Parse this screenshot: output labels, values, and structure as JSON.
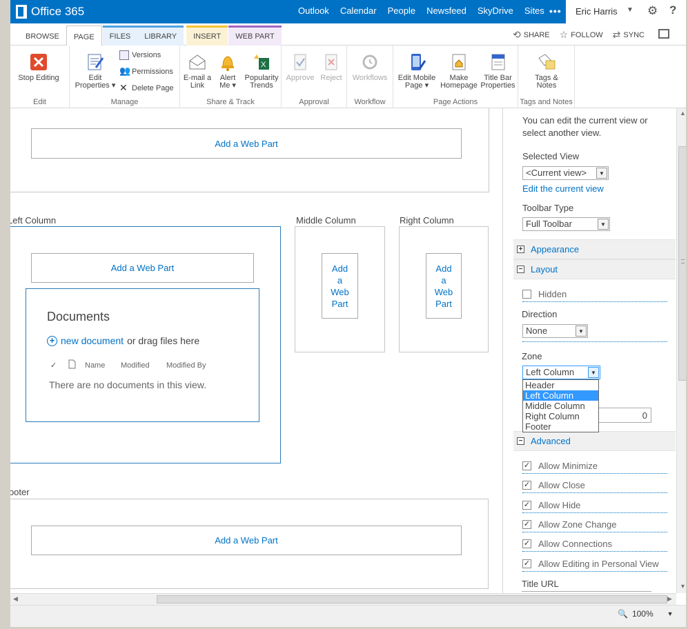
{
  "suite": {
    "brand": "Office 365",
    "nav": [
      "Outlook",
      "Calendar",
      "People",
      "Newsfeed",
      "SkyDrive",
      "Sites"
    ],
    "active_nav": "Sites",
    "more": "•••",
    "user": "Eric Harris",
    "help": "?"
  },
  "ribbon_tabs": {
    "browse": "BROWSE",
    "page": "PAGE",
    "files": "FILES",
    "library": "LIBRARY",
    "insert": "INSERT",
    "web_part": "WEB PART",
    "share": "SHARE",
    "follow": "FOLLOW",
    "sync": "SYNC"
  },
  "ribbon": {
    "edit": {
      "label": "Edit",
      "stop_editing": "Stop Editing"
    },
    "manage": {
      "label": "Manage",
      "edit_properties_1": "Edit",
      "edit_properties_2": "Properties",
      "versions": "Versions",
      "permissions": "Permissions",
      "delete_page": "Delete Page"
    },
    "share_track": {
      "label": "Share & Track",
      "email_1": "E-mail a",
      "email_2": "Link",
      "alert_1": "Alert",
      "alert_2": "Me",
      "popularity_1": "Popularity",
      "popularity_2": "Trends"
    },
    "approval": {
      "label": "Approval",
      "approve": "Approve",
      "reject": "Reject"
    },
    "workflow": {
      "label": "Workflow",
      "workflows": "Workflows"
    },
    "page_actions": {
      "label": "Page Actions",
      "mobile_1": "Edit Mobile",
      "mobile_2": "Page",
      "home_1": "Make",
      "home_2": "Homepage",
      "titlebar_1": "Title Bar",
      "titlebar_2": "Properties"
    },
    "tags": {
      "label": "Tags and Notes",
      "tags_1": "Tags &",
      "tags_2": "Notes"
    }
  },
  "content": {
    "add_web_part": "Add a Web Part",
    "add_wp_narrow": [
      "Add",
      "a",
      "Web",
      "Part"
    ],
    "left_column": "Left Column",
    "middle_column": "Middle Column",
    "right_column": "Right Column",
    "footer": "Footer",
    "documents": {
      "title": "Documents",
      "new_document": "new document",
      "drag_text": "or drag files here",
      "col_name": "Name",
      "col_modified": "Modified",
      "col_modified_by": "Modified By",
      "empty": "There are no documents in this view."
    }
  },
  "toolpane": {
    "intro_1": "You can edit the current view or",
    "intro_2": "select another view.",
    "selected_view_label": "Selected View",
    "selected_view": "<Current view>",
    "edit_current_view": "Edit the current view",
    "toolbar_type_label": "Toolbar Type",
    "toolbar_type": "Full Toolbar",
    "appearance": "Appearance",
    "layout": "Layout",
    "hidden": "Hidden",
    "direction_label": "Direction",
    "direction": "None",
    "zone_label": "Zone",
    "zone": "Left Column",
    "zone_options": [
      "Header",
      "Left Column",
      "Middle Column",
      "Right Column",
      "Footer"
    ],
    "zone_index": "0",
    "advanced": "Advanced",
    "allow_minimize": "Allow Minimize",
    "allow_close": "Allow Close",
    "allow_hide": "Allow Hide",
    "allow_zone_change": "Allow Zone Change",
    "allow_connections": "Allow Connections",
    "allow_editing_personal": "Allow Editing in Personal View",
    "title_url_label": "Title URL"
  },
  "status": {
    "zoom": "100%"
  },
  "colors": {
    "suite_blue": "#0072c6",
    "link_blue": "#0072c6",
    "selected_option": "#3399ff"
  }
}
